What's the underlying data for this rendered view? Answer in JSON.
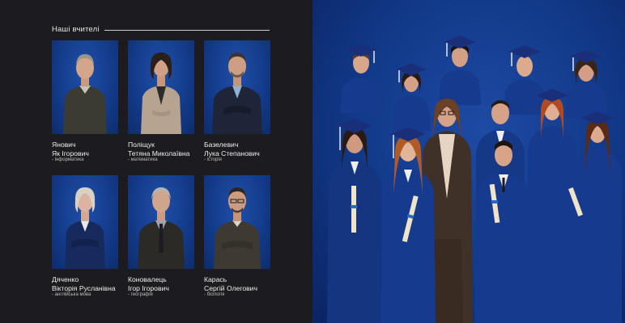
{
  "section": {
    "title": "Наші вчителі"
  },
  "teachers": [
    {
      "surname": "Янович",
      "given": "Як Ігорович",
      "subject": "- інформатика"
    },
    {
      "surname": "Поліщук",
      "given": "Тетяна Миколаївна",
      "subject": "- математика"
    },
    {
      "surname": "Базелевич",
      "given": "Лука Степанович",
      "subject": "- історія"
    },
    {
      "surname": "Дяченко",
      "given": "Вікторія Русланівна",
      "subject": "- англійська мова"
    },
    {
      "surname": "Коновалець",
      "given": "Ігор Ігорович",
      "subject": "- географія"
    },
    {
      "surname": "Карась",
      "given": "Сергій Олегович",
      "subject": "- біологія"
    }
  ],
  "colors": {
    "background": "#1c1c20",
    "portrait_backdrop": "#143c8c",
    "gown": "#163a8e"
  }
}
